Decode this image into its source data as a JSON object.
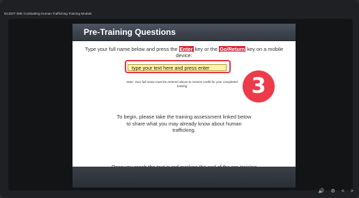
{
  "window": {
    "title": "NCDOT IMD Combatting Human Trafficking Training Module"
  },
  "slide": {
    "title": "Pre-Training Questions",
    "instruction_before": "Type your full name below and press the ",
    "enter_key": "Enter",
    "instruction_middle": " key or the ",
    "go_return_key": "Go/Return",
    "instruction_after": " key on a mobile device:",
    "input": {
      "value": "type your text here and press enter"
    },
    "note": "Note: Your full name must be entered above to receive credit for your completed training",
    "paragraph1": "To begin, please take the training assessment linked below to share what you may already know about human trafficking.",
    "paragraph2": "Once you reach the text in red marking the end of the pre-training questions, please advance to the next slide."
  },
  "badge": {
    "number": "3",
    "color": "#ec3c4a"
  },
  "player_controls": [
    {
      "name": "volume-icon",
      "glyph": "🔊"
    },
    {
      "name": "settings-icon",
      "glyph": "⚙"
    },
    {
      "name": "previous-icon",
      "glyph": "<"
    },
    {
      "name": "next-icon",
      "glyph": ">"
    }
  ]
}
